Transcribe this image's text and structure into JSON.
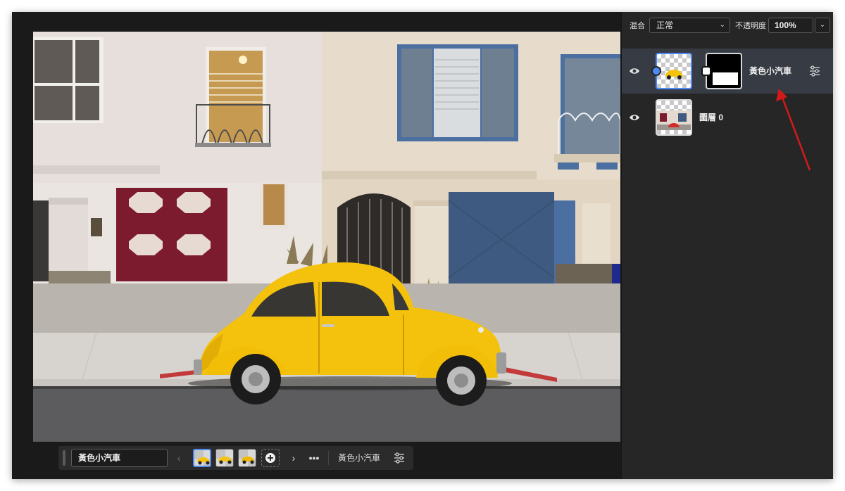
{
  "panel": {
    "blend_label": "混合",
    "blend_mode": "正常",
    "opacity_label": "不透明度",
    "opacity_value": "100%"
  },
  "layers": [
    {
      "name": "黃色小汽車",
      "active": true,
      "visible": true,
      "has_mask": true
    },
    {
      "name": "圖層 0",
      "active": false,
      "visible": true,
      "has_mask": false
    }
  ],
  "context_bar": {
    "layer_name_value": "黃色小汽車",
    "variation_count": 3,
    "selected_variation": 1,
    "prompt_text": "黃色小汽車"
  },
  "icons": {
    "visibility": "eye-icon",
    "properties": "sliders-icon",
    "add": "plus-circle-icon",
    "more": "more-horizontal-icon",
    "prev": "chevron-left-icon",
    "next": "chevron-right-icon",
    "dropdown": "chevron-down-icon"
  },
  "colors": {
    "accent": "#4c8bf5",
    "annotation_arrow": "#d31a1a",
    "car_yellow": "#f4c20d",
    "panel_bg": "#262626",
    "active_layer_bg": "#363b44"
  }
}
